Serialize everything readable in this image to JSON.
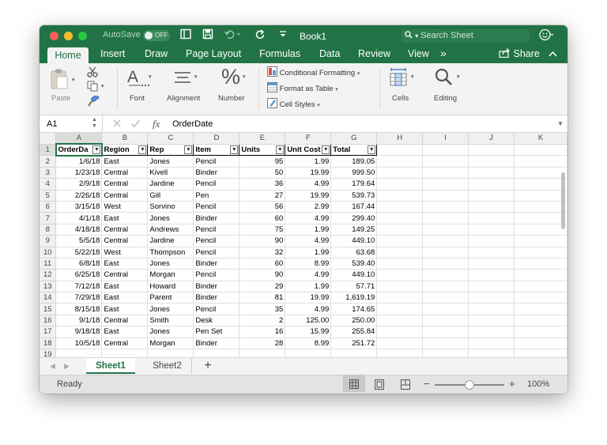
{
  "colors": {
    "accent": "#217346",
    "ribbon_bg": "#f3f3f3"
  },
  "titlebar": {
    "autosave_label": "AutoSave",
    "autosave_state": "OFF",
    "title": "Book1",
    "search_placeholder": "Search Sheet",
    "icons": [
      "sidebar-icon",
      "save-icon",
      "undo-icon",
      "redo-icon",
      "customize-icon",
      "account-icon"
    ]
  },
  "tabs": [
    "Home",
    "Insert",
    "Draw",
    "Page Layout",
    "Formulas",
    "Data",
    "Review",
    "View"
  ],
  "tabs_more": "»",
  "share_label": "Share",
  "ribbon": {
    "paste": "Paste",
    "font": "Font",
    "alignment": "Alignment",
    "number": "Number",
    "number_glyph": "%",
    "conditional": "Conditional Formatting",
    "format_table": "Format as Table",
    "cell_styles": "Cell Styles",
    "cells": "Cells",
    "editing": "Editing"
  },
  "formula_bar": {
    "name_box": "A1",
    "fx": "fx",
    "value": "OrderDate"
  },
  "sheet": {
    "columns": [
      "A",
      "B",
      "C",
      "D",
      "E",
      "F",
      "G",
      "H",
      "I",
      "J",
      "K"
    ],
    "headers": [
      "OrderDa",
      "Region",
      "Rep",
      "Item",
      "Units",
      "Unit Cost",
      "Total"
    ],
    "rows": [
      [
        "1/6/18",
        "East",
        "Jones",
        "Pencil",
        "95",
        "1.99",
        "189.05"
      ],
      [
        "1/23/18",
        "Central",
        "Kivell",
        "Binder",
        "50",
        "19.99",
        "999.50"
      ],
      [
        "2/9/18",
        "Central",
        "Jardine",
        "Pencil",
        "36",
        "4.99",
        "179.64"
      ],
      [
        "2/26/18",
        "Central",
        "Gill",
        "Pen",
        "27",
        "19.99",
        "539.73"
      ],
      [
        "3/15/18",
        "West",
        "Sorvino",
        "Pencil",
        "56",
        "2.99",
        "167.44"
      ],
      [
        "4/1/18",
        "East",
        "Jones",
        "Binder",
        "60",
        "4.99",
        "299.40"
      ],
      [
        "4/18/18",
        "Central",
        "Andrews",
        "Pencil",
        "75",
        "1.99",
        "149.25"
      ],
      [
        "5/5/18",
        "Central",
        "Jardine",
        "Pencil",
        "90",
        "4.99",
        "449.10"
      ],
      [
        "5/22/18",
        "West",
        "Thompson",
        "Pencil",
        "32",
        "1.99",
        "63.68"
      ],
      [
        "6/8/18",
        "East",
        "Jones",
        "Binder",
        "60",
        "8.99",
        "539.40"
      ],
      [
        "6/25/18",
        "Central",
        "Morgan",
        "Pencil",
        "90",
        "4.99",
        "449.10"
      ],
      [
        "7/12/18",
        "East",
        "Howard",
        "Binder",
        "29",
        "1.99",
        "57.71"
      ],
      [
        "7/29/18",
        "East",
        "Parent",
        "Binder",
        "81",
        "19.99",
        "1,619.19"
      ],
      [
        "8/15/18",
        "East",
        "Jones",
        "Pencil",
        "35",
        "4.99",
        "174.65"
      ],
      [
        "9/1/18",
        "Central",
        "Smith",
        "Desk",
        "2",
        "125.00",
        "250.00"
      ],
      [
        "9/18/18",
        "East",
        "Jones",
        "Pen Set",
        "16",
        "15.99",
        "255.84"
      ],
      [
        "10/5/18",
        "Central",
        "Morgan",
        "Binder",
        "28",
        "8.99",
        "251.72"
      ]
    ]
  },
  "sheet_tabs": [
    "Sheet1",
    "Sheet2"
  ],
  "add_sheet": "+",
  "status": {
    "ready": "Ready",
    "zoom": "100%",
    "zoom_minus": "−",
    "zoom_plus": "+",
    "zoom_level": 0.5
  }
}
